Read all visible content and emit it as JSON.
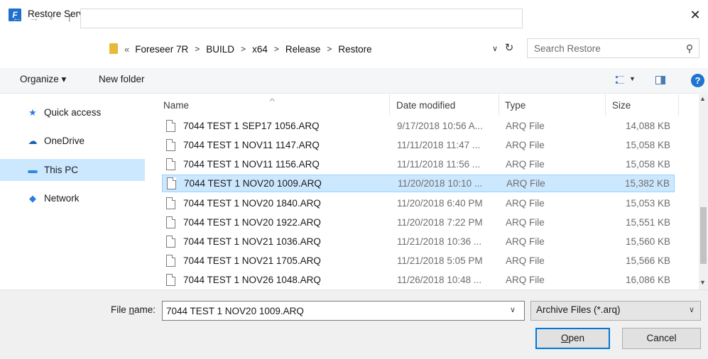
{
  "window": {
    "title": "Restore Server Configuration Backup From...",
    "close_glyph": "✕"
  },
  "address": {
    "overflow": "«",
    "crumbs": [
      "Foreseer 7R",
      "BUILD",
      "x64",
      "Release",
      "Restore"
    ],
    "search_placeholder": "Search Restore"
  },
  "toolbar": {
    "organize_label": "Organize ▾",
    "new_folder_label": "New folder",
    "help_label": "?"
  },
  "sidebar": {
    "items": [
      {
        "label": "Quick access",
        "icon": "star-icon"
      },
      {
        "label": "OneDrive",
        "icon": "cloud-icon"
      },
      {
        "label": "This PC",
        "icon": "computer-icon",
        "selected": true
      },
      {
        "label": "Network",
        "icon": "network-icon"
      }
    ]
  },
  "columns": {
    "name": "Name",
    "date": "Date modified",
    "type": "Type",
    "size": "Size"
  },
  "files": [
    {
      "name": "7044 TEST 1  SEP17 1056.ARQ",
      "date": "9/17/2018 10:56 A...",
      "type": "ARQ File",
      "size": "14,088 KB"
    },
    {
      "name": "7044 TEST 1 NOV11 1147.ARQ",
      "date": "11/11/2018 11:47 ...",
      "type": "ARQ File",
      "size": "15,058 KB"
    },
    {
      "name": "7044 TEST 1 NOV11 1156.ARQ",
      "date": "11/11/2018 11:56 ...",
      "type": "ARQ File",
      "size": "15,058 KB"
    },
    {
      "name": "7044 TEST 1 NOV20 1009.ARQ",
      "date": "11/20/2018 10:10 ...",
      "type": "ARQ File",
      "size": "15,382 KB",
      "selected": true
    },
    {
      "name": "7044 TEST 1 NOV20 1840.ARQ",
      "date": "11/20/2018 6:40 PM",
      "type": "ARQ File",
      "size": "15,053 KB"
    },
    {
      "name": "7044 TEST 1 NOV20 1922.ARQ",
      "date": "11/20/2018 7:22 PM",
      "type": "ARQ File",
      "size": "15,551 KB"
    },
    {
      "name": "7044 TEST 1 NOV21 1036.ARQ",
      "date": "11/21/2018 10:36 ...",
      "type": "ARQ File",
      "size": "15,560 KB"
    },
    {
      "name": "7044 TEST 1 NOV21 1705.ARQ",
      "date": "11/21/2018 5:05 PM",
      "type": "ARQ File",
      "size": "15,566 KB"
    },
    {
      "name": "7044 TEST 1 NOV26 1048.ARQ",
      "date": "11/26/2018 10:48 ...",
      "type": "ARQ File",
      "size": "16,086 KB"
    }
  ],
  "footer": {
    "file_name_label_pre": "File ",
    "file_name_label_accel": "n",
    "file_name_label_post": "ame:",
    "file_name_value": "7044 TEST 1 NOV20 1009.ARQ",
    "filter_label": "Archive Files (*.arq)",
    "open_accel": "O",
    "open_rest": "pen",
    "cancel_label": "Cancel"
  },
  "colors": {
    "selection": "#cce8ff",
    "selection_border": "#99d1ff",
    "accent": "#0078d7"
  }
}
